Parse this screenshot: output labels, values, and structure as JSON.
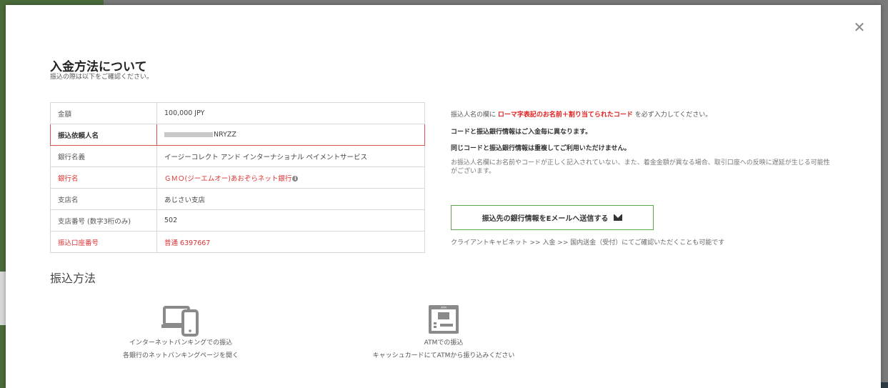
{
  "modal": {
    "title": "入金方法について",
    "subtitle": "振込の際は以下をご確認ください。",
    "close_icon": "close-icon"
  },
  "table": {
    "rows": [
      {
        "label": "金額",
        "value": "100,000 JPY"
      },
      {
        "label": "振込依頼人名",
        "value": "NRYZZ"
      },
      {
        "label": "銀行名義",
        "value": "イージーコレクト アンド インターナショナル ペイメントサービス"
      },
      {
        "label": "銀行名",
        "value": "ＧＭＯ(ジーエムオー)あおぞらネット銀行"
      },
      {
        "label": "支店名",
        "value": "あじさい支店"
      },
      {
        "label": "支店番号 (数字3桁のみ)",
        "value": "502"
      },
      {
        "label": "振込口座番号",
        "value": "普通 6397667"
      }
    ]
  },
  "notes": {
    "line1_pre": "振込人名の欄に",
    "line1_em": "ローマ字表記のお名前＋割り当てられたコード",
    "line1_post": "を必ず入力してください。",
    "line2": "コードと振込銀行情報はご入金毎に異なります。",
    "line3": "同じコードと振込銀行情報は重複してご利用いただけません。",
    "line4": "お振込人名欄にお名前やコードが正しく記入されていない、また、着金金額が異なる場合、取引口座への反映に遅延が生じる可能性がございます。"
  },
  "email_button": {
    "label": "振込先の銀行情報をEメールへ送信する",
    "icon": "envelope-icon"
  },
  "cabinet_text": "クライアントキャビネット >> 入金 >> 国内送金（受付）にてご確認いただくことも可能です",
  "methods": {
    "title": "振込方法",
    "items": [
      {
        "icon": "devices-icon",
        "line1": "インターネットバンキングでの振込",
        "line2": "各銀行のネットバンキングページを開く"
      },
      {
        "icon": "atm-icon",
        "line1": "ATMでの振込",
        "line2": "キャッシュカードにてATMから振り込みください"
      }
    ]
  },
  "colors": {
    "accent_red": "#e02020",
    "button_border": "#5aa84a",
    "highlight_border": "#d9534f"
  }
}
